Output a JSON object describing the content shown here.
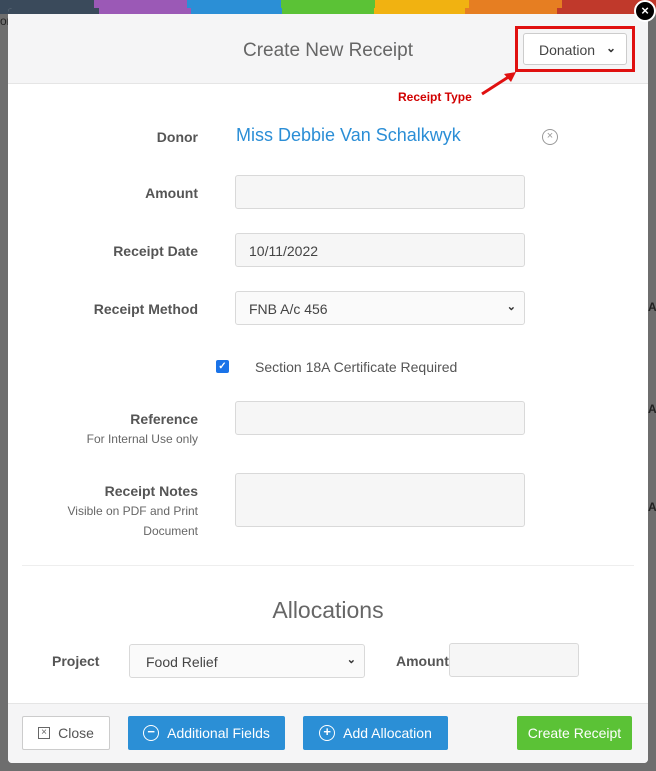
{
  "colors": {
    "accent_blue": "#2b8fd6",
    "accent_green": "#5bc236",
    "annotation_red": "#e01010",
    "topbar": [
      "#3a4a5b",
      "#9b59b6",
      "#2b8fd6",
      "#5bc236",
      "#f1b211",
      "#e67e22",
      "#c0392b"
    ]
  },
  "modal": {
    "title": "Create New Receipt",
    "receipt_type": "Donation",
    "annotation": "Receipt Type"
  },
  "form": {
    "donor_label": "Donor",
    "donor_name": "Miss Debbie Van Schalkwyk",
    "amount_label": "Amount",
    "amount_value": "",
    "date_label": "Receipt Date",
    "date_value": "10/11/2022",
    "method_label": "Receipt Method",
    "method_value": "FNB A/c 456",
    "certificate_label": "Section 18A Certificate Required",
    "certificate_checked": true,
    "reference_label": "Reference",
    "reference_sub": "For Internal Use only",
    "reference_value": "",
    "notes_label": "Receipt Notes",
    "notes_sub": "Visible on PDF and Print Document",
    "notes_value": ""
  },
  "allocations": {
    "title": "Allocations",
    "project_label": "Project",
    "project_value": "Food Relief",
    "amount_label": "Amount",
    "amount_value": ""
  },
  "footer": {
    "close_label": "Close",
    "additional_label": "Additional Fields",
    "add_alloc_label": "Add Allocation",
    "create_label": "Create Receipt"
  },
  "background": {
    "frag_top": "or",
    "frag_right_1": "AI",
    "frag_right_2": "AI",
    "frag_right_3": "AI"
  }
}
